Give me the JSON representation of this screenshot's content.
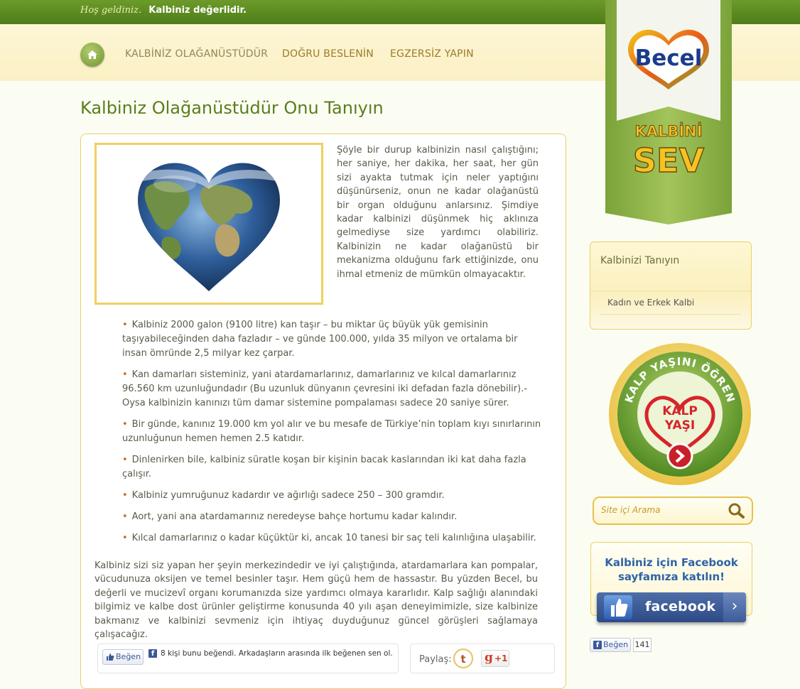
{
  "topbar": {
    "greeting": "Hoş geldiniz.",
    "tagline": "Kalbiniz değerlidir."
  },
  "nav": {
    "items": [
      "KALBİNİZ OLAĞANÜSTÜDÜR",
      "DOĞRU BESLENİN",
      "EGZERSİZ YAPIN"
    ]
  },
  "page": {
    "title": "Kalbiniz Olağanüstüdür Onu Tanıyın"
  },
  "intro": "Şöyle bir durup kalbinizin nasıl çalıştığını; her saniye, her dakika, her saat, her gün sizi ayakta tutmak için neler yaptığını düşünürseniz, onun ne kadar olağanüstü bir organ olduğunu anlarsınız. Şimdiye kadar kalbinizi düşünmek hiç aklınıza gelmediyse size yardımcı olabiliriz. Kalbinizin ne kadar olağanüstü bir mekanizma olduğunu fark ettiğinizde, onu ihmal etmeniz de mümkün olmayacaktır.",
  "facts": [
    "Kalbiniz 2000 galon (9100 litre) kan taşır – bu miktar üç büyük yük gemisinin taşıyabileceğinden daha fazladır – ve günde 100.000, yılda 35 milyon ve ortalama bir insan ömründe 2,5 milyar kez çarpar.",
    "Kan damarları sisteminiz, yani atardamarlarınız, damarlarınız ve kılcal damarlarınız 96.560 km uzunluğundadır (Bu uzunluk dünyanın çevresini iki defadan fazla dönebilir).-Oysa kalbinizin kanınızı tüm damar sistemine pompalaması sadece 20 saniye sürer.",
    "Bir günde, kanınız 19.000 km yol alır ve bu mesafe de Türkiye’nin toplam kıyı sınırlarının uzunluğunun hemen hemen 2.5 katıdır.",
    "Dinlenirken bile, kalbiniz süratle koşan bir kişinin bacak kaslarından iki kat daha fazla çalışır.",
    "Kalbiniz yumruğunuz kadardır ve ağırlığı sadece 250 – 300 gramdır.",
    "Aort, yani ana atardamarınız neredeyse bahçe hortumu kadar kalındır.",
    "Kılcal damarlarınız o kadar küçüktür ki, ancak 10 tanesi bir saç teli kalınlığına ulaşabilir."
  ],
  "outro": "Kalbiniz sizi siz yapan her şeyin merkezindedir ve iyi çalıştığında, atardamarlara kan pompalar, vücudunuza oksijen ve temel besinler taşır. Hem güçü hem de hassastır. Bu yüzden Becel, bu değerli ve mucizevî organı korumanızda size yardımcı olmaya kararlıdır. Kalp sağlığı alanındaki bilgimiz ve kalbe dost ürünler geliştirme konusunda 40 yılı aşan deneyimimizle, size kalbinize bakmanız ve kalbinizi sevmeniz için ihtiyaç duyduğunuz güncel görüşleri sağlamaya çalışacağız.",
  "social": {
    "like_label": "Beğen",
    "like_text": "8 kişi bunu beğendi. Arkadaşların arasında ilk beğenen sen ol.",
    "share_label": "Paylaş:",
    "tumblr": "t",
    "gplus": "+1"
  },
  "brand": {
    "logo": "Becel",
    "ribbon_line1": "KALBİNİ",
    "ribbon_line2": "SEV"
  },
  "sidebar": {
    "box_title": "Kalbinizi Tanıyın",
    "box_item": "Kadın ve Erkek Kalbi",
    "badge_arc": "KALP YAŞINI ÖĞREN",
    "badge_line1": "KALP",
    "badge_line2": "YAŞI",
    "search_placeholder": "Site içi Arama",
    "fb_promo_line1": "Kalbiniz için Facebook",
    "fb_promo_line2": "sayfamıza katılın!",
    "fb_word": "facebook",
    "like_label": "Beğen",
    "like_count": "141"
  },
  "colors": {
    "green_dark": "#4f7d19",
    "green_title": "#5a7d1c",
    "gold_border": "#e9cf6a",
    "nav_text": "#9b7a26",
    "bullet": "#cc6a1b"
  }
}
